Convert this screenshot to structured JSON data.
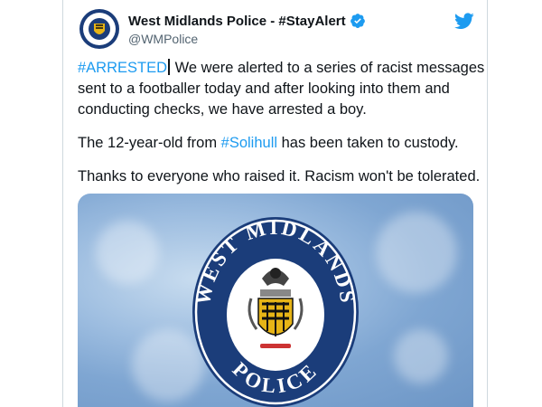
{
  "tweet": {
    "display_name": "West Midlands Police - #StayAlert",
    "handle": "@WMPolice",
    "hashtag_arrested": "#ARRESTED",
    "line1_rest": " We were alerted to a series of racist messages sent to a footballer today and after looking into them and conducting checks, we have arrested a boy.",
    "line2_before": "The 12-year-old from ",
    "hashtag_solihull": "#Solihull",
    "line2_after": " has been taken to custody.",
    "line3": "Thanks to everyone who raised it. Racism won't be tolerated."
  },
  "media": {
    "badge_top_text": "WEST MIDLANDS",
    "badge_bottom_text": "POLICE"
  },
  "icons": {
    "verified": "verified-badge-icon",
    "platform": "twitter-bird-icon"
  },
  "colors": {
    "link": "#1d9bf0",
    "badge_blue": "#1b3d7a",
    "text": "#0f1419",
    "secondary": "#536471"
  }
}
